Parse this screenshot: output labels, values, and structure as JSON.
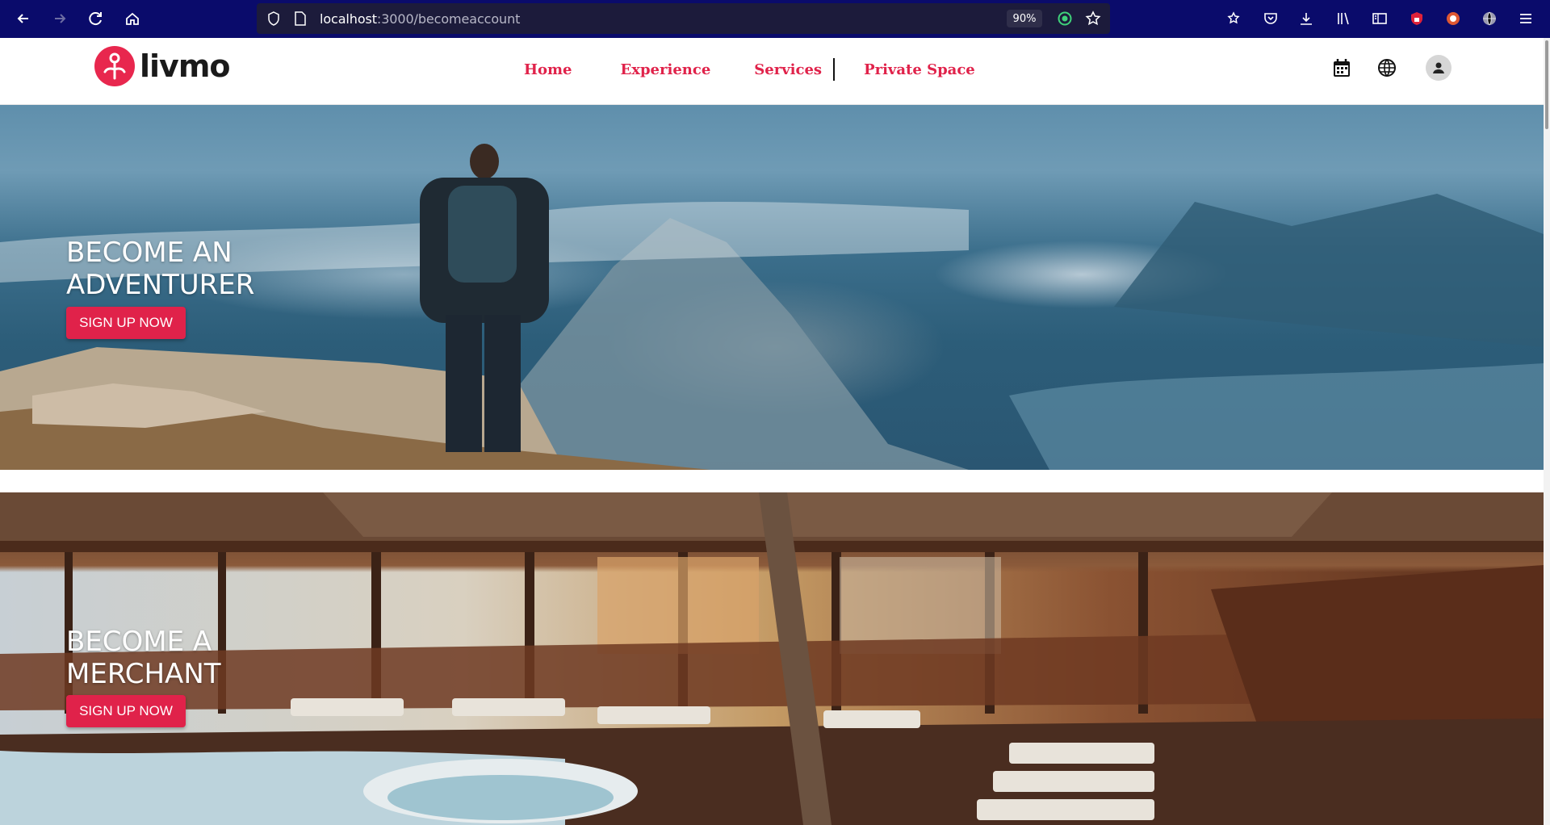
{
  "browser": {
    "url_host": "localhost",
    "url_path": ":3000/becomeaccount",
    "zoom": "90%"
  },
  "header": {
    "logo_text": "livmo",
    "nav": [
      {
        "label": "Home"
      },
      {
        "label": "Experience"
      },
      {
        "label": "Services"
      },
      {
        "label": "Private Space"
      }
    ]
  },
  "banners": [
    {
      "title_line1": "BECOME AN",
      "title_line2": "ADVENTURER",
      "button": "SIGN UP NOW"
    },
    {
      "title_line1": "BECOME A",
      "title_line2": "MERCHANT",
      "button": "SIGN UP NOW"
    }
  ],
  "colors": {
    "brand": "#e0224a",
    "browser_bar": "#0a0b6b"
  }
}
